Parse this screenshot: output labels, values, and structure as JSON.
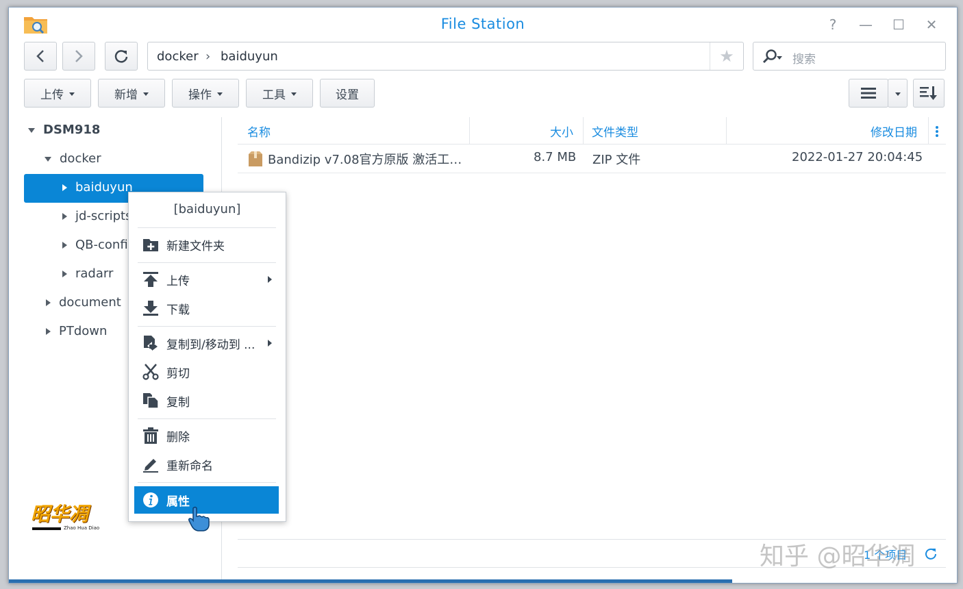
{
  "window": {
    "title": "File Station",
    "controls": [
      "?",
      "—",
      "☐",
      "✕"
    ]
  },
  "nav": {
    "back_icon": "chevron-left-icon",
    "forward_icon": "chevron-right-icon",
    "refresh_icon": "refresh-icon",
    "path": [
      "docker",
      "baiduyun"
    ],
    "path_sep": "›",
    "favorite_icon": "star-icon",
    "search_placeholder": "搜索"
  },
  "toolbar": {
    "upload": "上传",
    "create": "新增",
    "action": "操作",
    "tools": "工具",
    "settings": "设置"
  },
  "tree": {
    "root": "DSM918",
    "items": [
      {
        "label": "docker"
      },
      {
        "label": "baiduyun"
      },
      {
        "label": "jd-scripts"
      },
      {
        "label": "QB-config"
      },
      {
        "label": "radarr"
      },
      {
        "label": "document"
      },
      {
        "label": "PTdown"
      }
    ]
  },
  "table": {
    "headers": {
      "name": "名称",
      "size": "大小",
      "type": "文件类型",
      "modified": "修改日期"
    },
    "rows": [
      {
        "name": "Bandizip v7.08官方原版 激活工…",
        "size": "8.7 MB",
        "type": "ZIP 文件",
        "modified": "2022-01-27 20:04:45"
      }
    ]
  },
  "context_menu": {
    "title": "[baiduyun]",
    "items": [
      {
        "label": "新建文件夹",
        "icon": "new-folder-icon"
      },
      {
        "label": "上传",
        "icon": "upload-icon"
      },
      {
        "label": "下载",
        "icon": "download-icon"
      },
      {
        "label": "复制到/移动到 ...",
        "icon": "copy-move-icon"
      },
      {
        "label": "剪切",
        "icon": "scissors-icon"
      },
      {
        "label": "复制",
        "icon": "copy-icon"
      },
      {
        "label": "删除",
        "icon": "trash-icon"
      },
      {
        "label": "重新命名",
        "icon": "rename-pen-icon"
      },
      {
        "label": "属性",
        "icon": "info-icon"
      }
    ]
  },
  "status": {
    "items_count": "1 个项目"
  },
  "watermarks": {
    "logo_text": "昭华凋",
    "logo_sub": "Zhao Hua Diao",
    "zhihu": "知乎 @昭华凋"
  },
  "colors": {
    "accent": "#0a86d6",
    "title": "#1a8ce0",
    "text": "#3c4753"
  }
}
